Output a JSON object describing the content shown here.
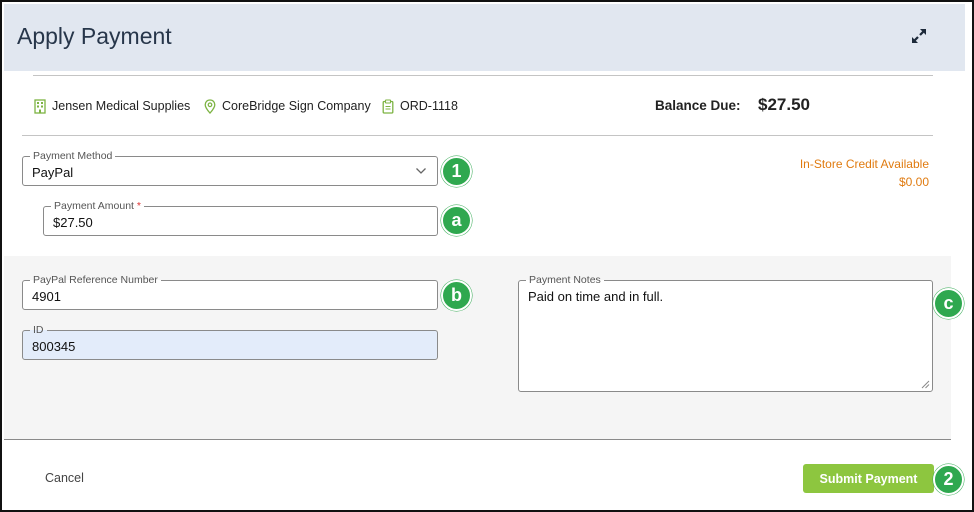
{
  "header": {
    "title": "Apply Payment",
    "expand_icon": "expand-icon"
  },
  "context": {
    "company": "Jensen Medical Supplies",
    "location": "CoreBridge Sign Company",
    "order": "ORD-1118",
    "balance_label": "Balance Due:",
    "balance_value": "$27.50"
  },
  "payment_method": {
    "legend": "Payment Method",
    "value": "PayPal"
  },
  "payment_amount": {
    "legend": "Payment Amount",
    "required_mark": "*",
    "value": "$27.50"
  },
  "credit": {
    "label": "In-Store Credit Available",
    "value": "$0.00"
  },
  "paypal_ref": {
    "legend": "PayPal Reference Number",
    "value": "4901"
  },
  "id_field": {
    "legend": "ID",
    "value": "800345"
  },
  "notes": {
    "legend": "Payment Notes",
    "value": "Paid on time and in full."
  },
  "footer": {
    "cancel_label": "Cancel",
    "submit_label": "Submit Payment"
  },
  "callouts": {
    "one": "1",
    "a": "a",
    "b": "b",
    "c": "c",
    "two": "2"
  },
  "colors": {
    "header_bg": "#e1e7f0",
    "accent_green": "#8dc63f",
    "badge_green": "#2fa84f",
    "credit_orange": "#e07b10",
    "id_bg": "#e3ecfa"
  }
}
